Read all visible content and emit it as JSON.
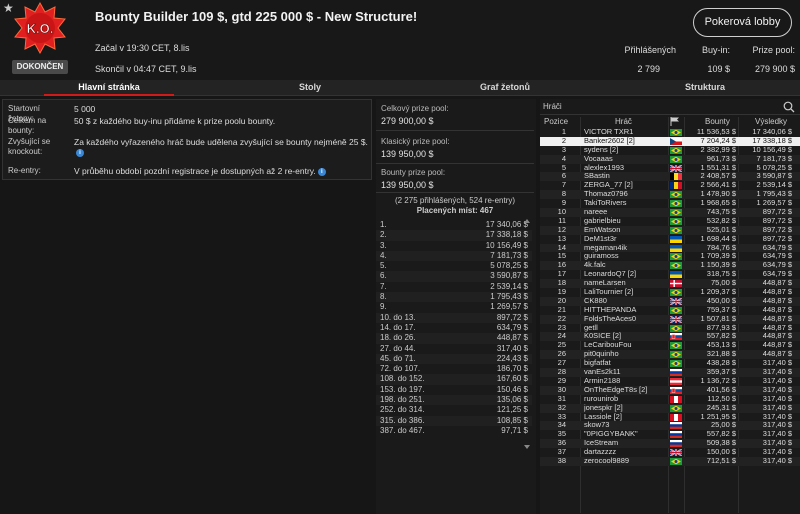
{
  "header": {
    "title": "Bounty Builder 109 $, gtd 225 000 $ - New Structure!",
    "logo_text": "K.O.",
    "status": "DOKONČEN",
    "started": "Začal v 19:30 CET, 8.lis",
    "ended": "Skončil v 04:47 CET, 9.lis",
    "lobby_button": "Pokerová lobby",
    "stats": {
      "registered_label": "Přihlášených",
      "registered_value": "2 799",
      "buyin_label": "Buy-in:",
      "buyin_value": "109 $",
      "prizepool_label": "Prize pool:",
      "prizepool_value": "279 900 $"
    }
  },
  "tabs": [
    {
      "label": "Hlavní stránka",
      "active": true
    },
    {
      "label": "Stoly",
      "active": false
    },
    {
      "label": "Graf žetonů",
      "active": false
    },
    {
      "label": "Struktura",
      "active": false
    }
  ],
  "info": {
    "start_chips_label": "Startovní žetony:",
    "start_chips_value": "5 000",
    "total_bounties_label": "Celkem na bounty:",
    "total_bounties_value": "50 $ z každého buy-inu přidáme k prize poolu bounty.",
    "increasing_label": "Zvyšující se knockout:",
    "increasing_value": "Za každého vyřazeného hráč bude udělena zvyšující se bounty nejméně 25 $.",
    "reentry_label": "Re-entry:",
    "reentry_value": "V průběhu období pozdní registrace je dostupných až 2 re-entry."
  },
  "pools": {
    "total_label": "Celkový prize pool:",
    "total_value": "279 900,00 $",
    "classic_label": "Klasický prize pool:",
    "classic_value": "139 950,00 $",
    "bounty_label": "Bounty prize pool:",
    "bounty_value": "139 950,00 $",
    "entries_note": "(2 275 přihlášených, 524 re-entry)",
    "paid_note": "Placených míst: 467"
  },
  "payouts": [
    {
      "place": "1.",
      "amount": "17 340,06 $"
    },
    {
      "place": "2.",
      "amount": "17 338,18 $"
    },
    {
      "place": "3.",
      "amount": "10 156,49 $"
    },
    {
      "place": "4.",
      "amount": "7 181,73 $"
    },
    {
      "place": "5.",
      "amount": "5 078,25 $"
    },
    {
      "place": "6.",
      "amount": "3 590,87 $"
    },
    {
      "place": "7.",
      "amount": "2 539,14 $"
    },
    {
      "place": "8.",
      "amount": "1 795,43 $"
    },
    {
      "place": "9.",
      "amount": "1 269,57 $"
    },
    {
      "place": "10. do 13.",
      "amount": "897,72 $"
    },
    {
      "place": "14. do 17.",
      "amount": "634,79 $"
    },
    {
      "place": "18. do 26.",
      "amount": "448,87 $"
    },
    {
      "place": "27. do 44.",
      "amount": "317,40 $"
    },
    {
      "place": "45. do 71.",
      "amount": "224,43 $"
    },
    {
      "place": "72. do 107.",
      "amount": "186,70 $"
    },
    {
      "place": "108. do 152.",
      "amount": "167,60 $"
    },
    {
      "place": "153. do 197.",
      "amount": "150,46 $"
    },
    {
      "place": "198. do 251.",
      "amount": "135,06 $"
    },
    {
      "place": "252. do 314.",
      "amount": "121,25 $"
    },
    {
      "place": "315. do 386.",
      "amount": "108,85 $"
    },
    {
      "place": "387. do 467.",
      "amount": "97,71 $"
    }
  ],
  "players_panel": {
    "search_label": "Hráči",
    "col_pos": "Pozice",
    "col_player": "Hráč",
    "col_bounty": "Bounty",
    "col_result": "Výsledky"
  },
  "players": [
    {
      "pos": "1",
      "name": "VICTOR TXR1",
      "flag": "br",
      "bounty": "11 536,53 $",
      "result": "17 340,06 $"
    },
    {
      "pos": "2",
      "name": "Banker2602 [2]",
      "flag": "cz",
      "bounty": "7 204,24 $",
      "result": "17 338,18 $"
    },
    {
      "pos": "3",
      "name": "sydens [2]",
      "flag": "br",
      "bounty": "2 382,99 $",
      "result": "10 156,49 $"
    },
    {
      "pos": "4",
      "name": "Vocaaas",
      "flag": "br",
      "bounty": "961,73 $",
      "result": "7 181,73 $"
    },
    {
      "pos": "5",
      "name": "alexlex1993",
      "flag": "gb",
      "bounty": "1 551,31 $",
      "result": "5 078,25 $"
    },
    {
      "pos": "6",
      "name": "SBastin",
      "flag": "be",
      "bounty": "2 408,57 $",
      "result": "3 590,87 $"
    },
    {
      "pos": "7",
      "name": "ZERGA_77 [2]",
      "flag": "ro",
      "bounty": "2 566,41 $",
      "result": "2 539,14 $"
    },
    {
      "pos": "8",
      "name": "Thomaz0796",
      "flag": "br",
      "bounty": "1 478,90 $",
      "result": "1 795,43 $"
    },
    {
      "pos": "9",
      "name": "TakiToRivers",
      "flag": "br",
      "bounty": "1 968,65 $",
      "result": "1 269,57 $"
    },
    {
      "pos": "10",
      "name": "nareee",
      "flag": "br",
      "bounty": "743,75 $",
      "result": "897,72 $"
    },
    {
      "pos": "11",
      "name": "gabrielbieu",
      "flag": "br",
      "bounty": "532,82 $",
      "result": "897,72 $"
    },
    {
      "pos": "12",
      "name": "EmWatson",
      "flag": "br",
      "bounty": "525,01 $",
      "result": "897,72 $"
    },
    {
      "pos": "13",
      "name": "DeM1st3r",
      "flag": "ua",
      "bounty": "1 698,44 $",
      "result": "897,72 $"
    },
    {
      "pos": "14",
      "name": "megaman4ik",
      "flag": "ua",
      "bounty": "784,76 $",
      "result": "634,79 $"
    },
    {
      "pos": "15",
      "name": "guiramoss",
      "flag": "br",
      "bounty": "1 709,39 $",
      "result": "634,79 $"
    },
    {
      "pos": "16",
      "name": "4k.falc",
      "flag": "br",
      "bounty": "1 150,39 $",
      "result": "634,79 $"
    },
    {
      "pos": "17",
      "name": "LeonardoQ7 [2]",
      "flag": "ua",
      "bounty": "318,75 $",
      "result": "634,79 $"
    },
    {
      "pos": "18",
      "name": "nameLarsen",
      "flag": "dk",
      "bounty": "75,00 $",
      "result": "448,87 $"
    },
    {
      "pos": "19",
      "name": "LaliTournier [2]",
      "flag": "br",
      "bounty": "1 209,37 $",
      "result": "448,87 $"
    },
    {
      "pos": "20",
      "name": "CK880",
      "flag": "gb",
      "bounty": "450,00 $",
      "result": "448,87 $"
    },
    {
      "pos": "21",
      "name": "HITTHEPANDA",
      "flag": "br",
      "bounty": "759,37 $",
      "result": "448,87 $"
    },
    {
      "pos": "22",
      "name": "FoldsTheAces0",
      "flag": "gb",
      "bounty": "1 507,81 $",
      "result": "448,87 $"
    },
    {
      "pos": "23",
      "name": "getll",
      "flag": "br",
      "bounty": "877,93 $",
      "result": "448,87 $"
    },
    {
      "pos": "24",
      "name": "K0SICE [2]",
      "flag": "sk",
      "bounty": "557,82 $",
      "result": "448,87 $"
    },
    {
      "pos": "25",
      "name": "LeCaribouFou",
      "flag": "br",
      "bounty": "453,13 $",
      "result": "448,87 $"
    },
    {
      "pos": "26",
      "name": "pit0quinho",
      "flag": "br",
      "bounty": "321,88 $",
      "result": "448,87 $"
    },
    {
      "pos": "27",
      "name": "bigfatfat",
      "flag": "br",
      "bounty": "438,28 $",
      "result": "317,40 $"
    },
    {
      "pos": "28",
      "name": "vanEs2k11",
      "flag": "ru",
      "bounty": "359,37 $",
      "result": "317,40 $"
    },
    {
      "pos": "29",
      "name": "Armin2188",
      "flag": "at",
      "bounty": "1 136,72 $",
      "result": "317,40 $"
    },
    {
      "pos": "30",
      "name": "OnTheEdgeT8s [2]",
      "flag": "sk",
      "bounty": "401,56 $",
      "result": "317,40 $"
    },
    {
      "pos": "31",
      "name": "rurounirob",
      "flag": "pe",
      "bounty": "112,50 $",
      "result": "317,40 $"
    },
    {
      "pos": "32",
      "name": "jonespkr [2]",
      "flag": "br",
      "bounty": "245,31 $",
      "result": "317,40 $"
    },
    {
      "pos": "33",
      "name": "Lassiole [2]",
      "flag": "pe",
      "bounty": "1 251,95 $",
      "result": "317,40 $"
    },
    {
      "pos": "34",
      "name": "skow73",
      "flag": "ru",
      "bounty": "25,00 $",
      "result": "317,40 $"
    },
    {
      "pos": "35",
      "name": "\"0PIGGYBANK\"",
      "flag": "ru",
      "bounty": "557,82 $",
      "result": "317,40 $"
    },
    {
      "pos": "36",
      "name": "IceStream",
      "flag": "ru",
      "bounty": "509,38 $",
      "result": "317,40 $"
    },
    {
      "pos": "37",
      "name": "dartazzzz",
      "flag": "gb",
      "bounty": "150,00 $",
      "result": "317,40 $"
    },
    {
      "pos": "38",
      "name": "zerocool9889",
      "flag": "br",
      "bounty": "712,51 $",
      "result": "317,40 $"
    }
  ],
  "selected_position": "2"
}
